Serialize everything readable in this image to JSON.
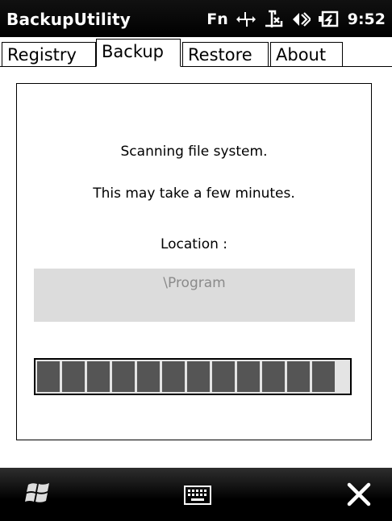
{
  "app": {
    "title": "BackupUtility"
  },
  "status_bar": {
    "fn_label": "Fn",
    "time": "9:52",
    "icons": [
      "data-transfer-icon",
      "signal-off-icon",
      "volume-mute-icon",
      "battery-charging-icon"
    ]
  },
  "tabs": [
    {
      "label": "Registry",
      "active": false
    },
    {
      "label": "Backup",
      "active": true
    },
    {
      "label": "Restore",
      "active": false
    },
    {
      "label": "About",
      "active": false
    }
  ],
  "backup": {
    "message_line1": "Scanning file system.",
    "message_line2": "This may take a few minutes.",
    "location_label": "Location :",
    "location_value": "\\Program",
    "progress_fraction": 0.92,
    "progress_blocks_filled": 12
  },
  "softkeys": {
    "left_icon": "windows-start-icon",
    "center_icon": "keyboard-icon",
    "right_icon": "close-icon"
  }
}
